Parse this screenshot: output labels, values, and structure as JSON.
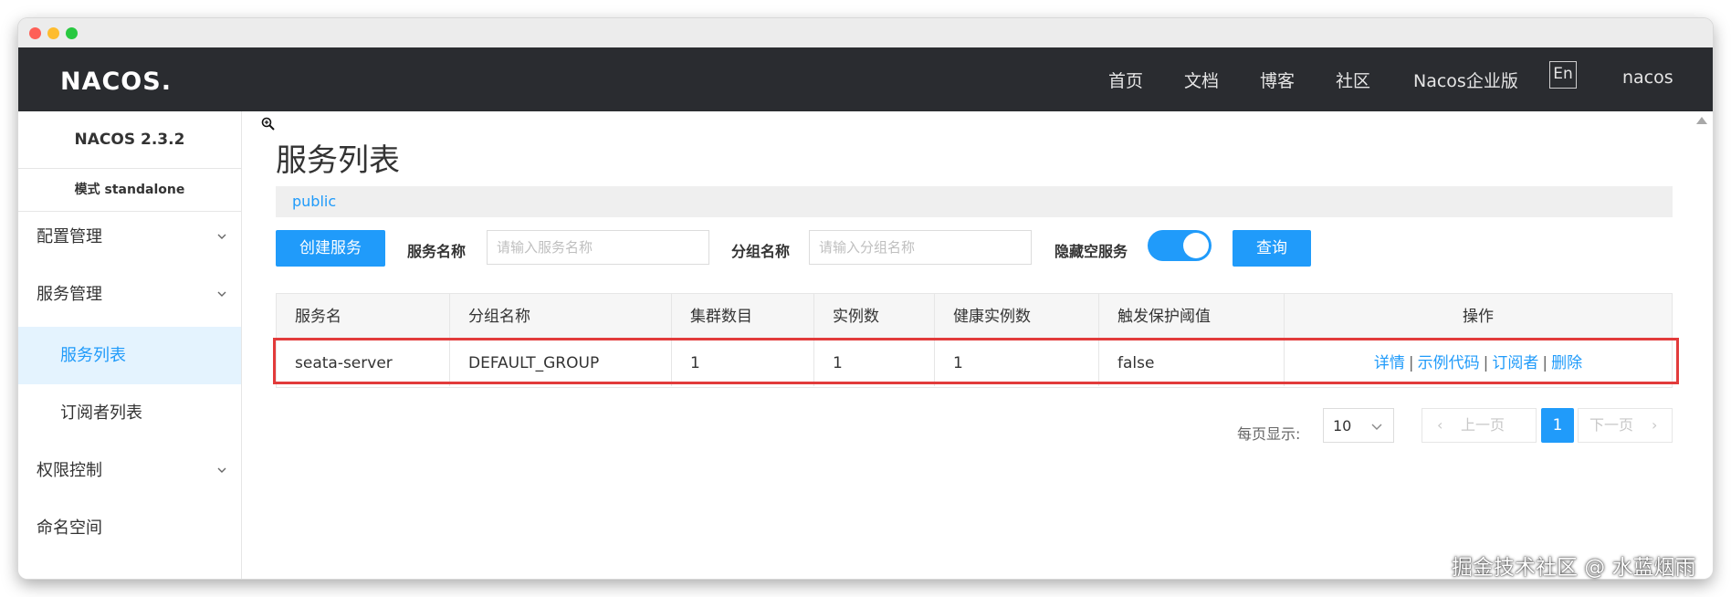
{
  "topnav": {
    "logo": "NACOS.",
    "links": [
      "首页",
      "文档",
      "博客",
      "社区",
      "Nacos企业版"
    ],
    "lang": "En",
    "user": "nacos"
  },
  "sidebar": {
    "version": "NACOS 2.3.2",
    "mode": "模式 standalone",
    "items": [
      {
        "label": "配置管理",
        "expandable": true
      },
      {
        "label": "服务管理",
        "expandable": true
      },
      {
        "label": "服务列表",
        "active": true
      },
      {
        "label": "订阅者列表"
      },
      {
        "label": "权限控制",
        "expandable": true
      },
      {
        "label": "命名空间"
      }
    ]
  },
  "main": {
    "title": "服务列表",
    "namespace": "public",
    "toolbar": {
      "create_label": "创建服务",
      "service_name_label": "服务名称",
      "service_name_placeholder": "请输入服务名称",
      "group_name_label": "分组名称",
      "group_name_placeholder": "请输入分组名称",
      "hide_empty_label": "隐藏空服务",
      "hide_empty_on": true,
      "query_label": "查询"
    },
    "table": {
      "headers": [
        "服务名",
        "分组名称",
        "集群数目",
        "实例数",
        "健康实例数",
        "触发保护阈值",
        "操作"
      ],
      "rows": [
        {
          "cells": [
            "seata-server",
            "DEFAULT_GROUP",
            "1",
            "1",
            "1",
            "false"
          ],
          "actions": [
            "详情",
            "示例代码",
            "订阅者",
            "删除"
          ]
        }
      ]
    },
    "pagination": {
      "page_size_label": "每页显示:",
      "page_size": "10",
      "prev": "上一页",
      "current": "1",
      "next": "下一页"
    }
  },
  "watermark": "掘金技术社区 @ 水蓝烟雨",
  "colors": {
    "accent": "#209bfa",
    "nav_bg": "#2a2c30",
    "highlight": "#e23b3b"
  }
}
